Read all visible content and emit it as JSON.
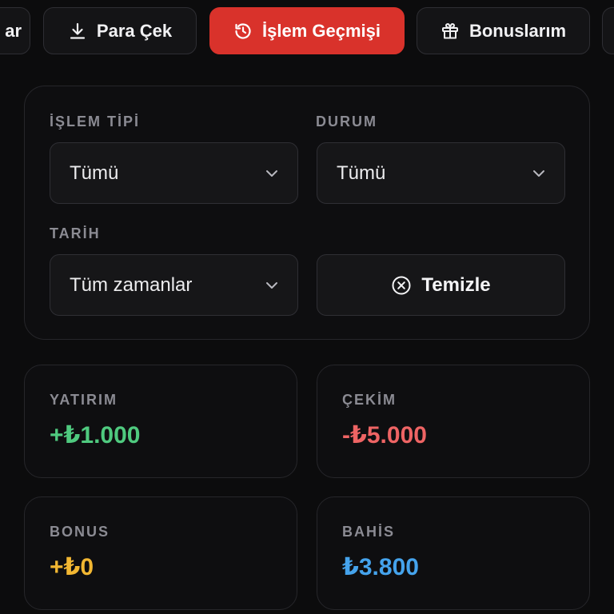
{
  "tabs": [
    {
      "label": "ar",
      "icon": "none",
      "active": false
    },
    {
      "label": "Para Çek",
      "icon": "download-icon",
      "active": false
    },
    {
      "label": "İşlem Geçmişi",
      "icon": "history-icon",
      "active": true
    },
    {
      "label": "Bonuslarım",
      "icon": "gift-icon",
      "active": false
    },
    {
      "label": "",
      "icon": "none",
      "active": false
    }
  ],
  "filters": {
    "type_label": "İŞLEM TİPİ",
    "type_value": "Tümü",
    "status_label": "DURUM",
    "status_value": "Tümü",
    "date_label": "TARİH",
    "date_value": "Tüm zamanlar",
    "clear_label": "Temizle"
  },
  "stats": [
    {
      "label": "YATIRIM",
      "value": "+₺1.000",
      "color": "#4fca7f"
    },
    {
      "label": "ÇEKİM",
      "value": "-₺5.000",
      "color": "#ee6464"
    },
    {
      "label": "BONUS",
      "value": "+₺0",
      "color": "#f2b732"
    },
    {
      "label": "BAHİS",
      "value": "₺3.800",
      "color": "#45a3ec"
    }
  ],
  "colors": {
    "accent": "#d9322b",
    "background": "#0c0c0d"
  }
}
